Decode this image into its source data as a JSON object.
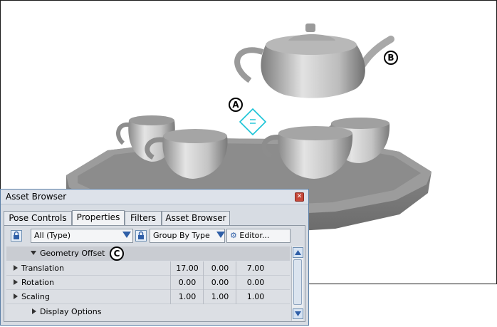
{
  "callouts": {
    "a": "A",
    "b": "B",
    "c": "C"
  },
  "window": {
    "title": "Asset Browser",
    "close_glyph": "✕"
  },
  "tabs": [
    "Pose Controls",
    "Properties",
    "Filters",
    "Asset Browser"
  ],
  "active_tab": "Properties",
  "toolbar": {
    "type_filter": "All (Type)",
    "group_by": "Group By Type",
    "editor": "Editor..."
  },
  "grid": {
    "group": "Geometry Offset",
    "rows": [
      {
        "label": "Translation",
        "values": [
          "17.00",
          "0.00",
          "7.00"
        ]
      },
      {
        "label": "Rotation",
        "values": [
          "0.00",
          "0.00",
          "0.00"
        ]
      },
      {
        "label": "Scaling",
        "values": [
          "1.00",
          "1.00",
          "1.00"
        ]
      }
    ],
    "footer": "Display Options"
  },
  "colors": {
    "accent_cyan": "#19c3d6",
    "window_border": "#5b7fa6",
    "dropdown_arrow": "#2f5fa8"
  }
}
